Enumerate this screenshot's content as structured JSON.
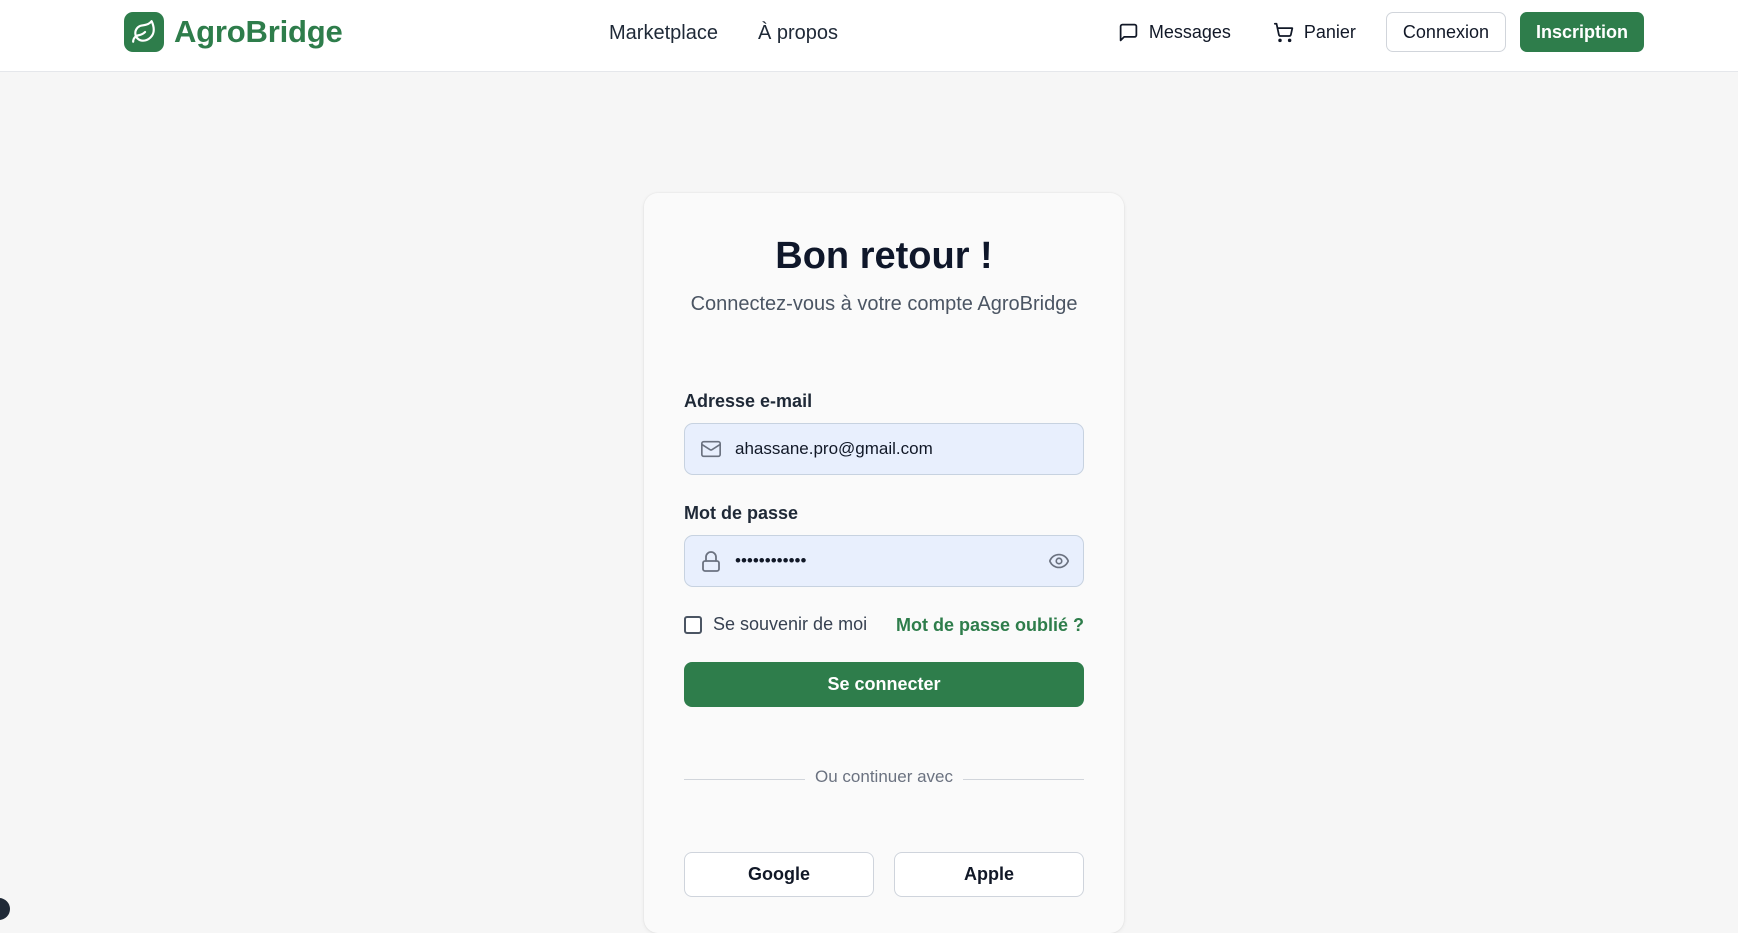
{
  "header": {
    "brand": "AgroBridge",
    "nav": [
      "Marketplace",
      "À propos"
    ],
    "messages_label": "Messages",
    "cart_label": "Panier",
    "login_label": "Connexion",
    "signup_label": "Inscription"
  },
  "login": {
    "title": "Bon retour !",
    "subtitle": "Connectez-vous à votre compte AgroBridge",
    "email_label": "Adresse e-mail",
    "email_value": "ahassane.pro@gmail.com",
    "password_label": "Mot de passe",
    "password_value": "••••••••••••",
    "remember_label": "Se souvenir de moi",
    "remember_checked": false,
    "forgot_label": "Mot de passe oublié ?",
    "submit_label": "Se connecter",
    "divider_label": "Ou continuer avec",
    "google_label": "Google",
    "apple_label": "Apple"
  },
  "icons": {
    "brand": "leaf-icon",
    "messages": "message-square-icon",
    "cart": "shopping-cart-icon",
    "email": "mail-icon",
    "password": "lock-icon",
    "toggle_password": "eye-icon"
  },
  "colors": {
    "brand_green": "#2e7d4b",
    "input_bg": "#e8effd",
    "page_bg": "#f6f6f6"
  }
}
